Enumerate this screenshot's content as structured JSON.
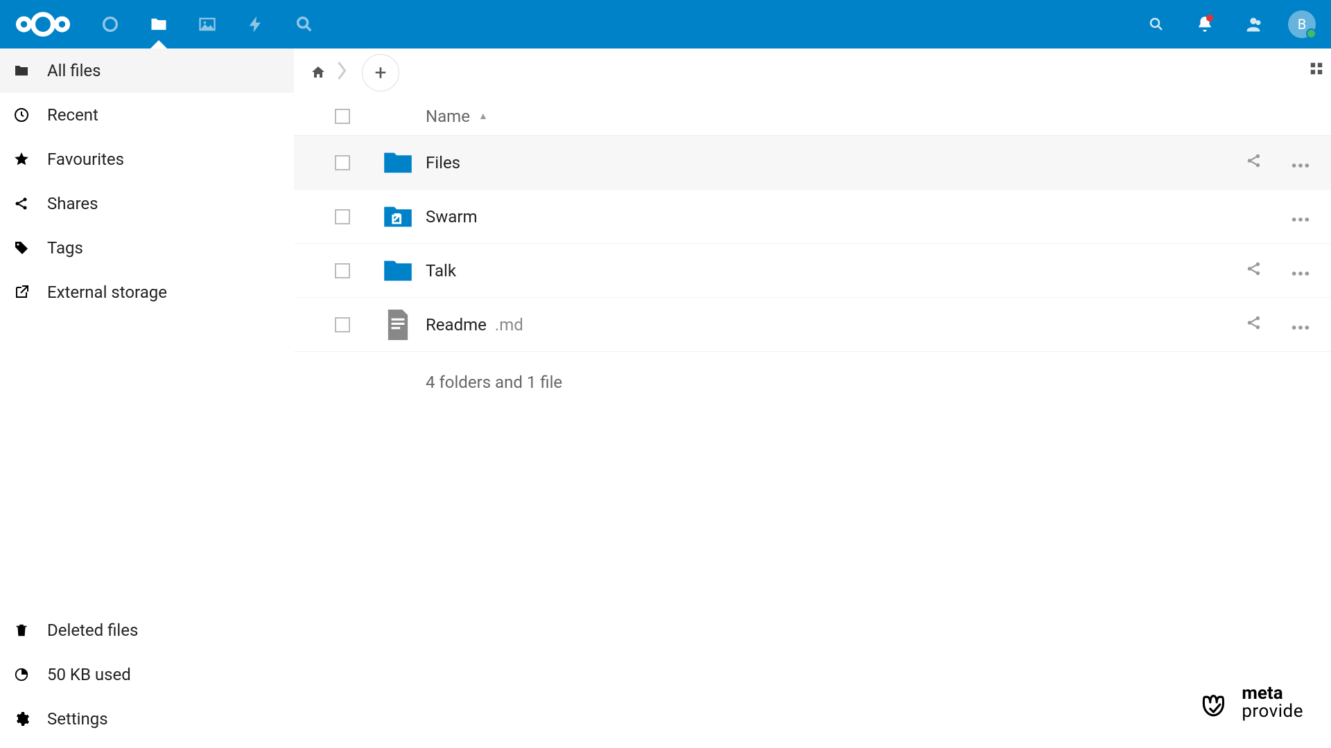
{
  "header": {
    "avatar_initial": "B"
  },
  "sidebar": {
    "items": [
      {
        "label": "All files"
      },
      {
        "label": "Recent"
      },
      {
        "label": "Favourites"
      },
      {
        "label": "Shares"
      },
      {
        "label": "Tags"
      },
      {
        "label": "External storage"
      }
    ],
    "bottom": {
      "deleted": "Deleted files",
      "quota": "50 KB used",
      "settings": "Settings"
    }
  },
  "table": {
    "header_name": "Name",
    "rows": [
      {
        "name": "Files",
        "ext": "",
        "icon": "folder",
        "share": true,
        "hover": true
      },
      {
        "name": "Swarm",
        "ext": "",
        "icon": "folder-external",
        "share": false,
        "hover": false
      },
      {
        "name": "Talk",
        "ext": "",
        "icon": "folder",
        "share": true,
        "hover": false
      },
      {
        "name": "Readme",
        "ext": ".md",
        "icon": "file-text",
        "share": true,
        "hover": false
      }
    ],
    "summary": "4 folders and 1 file"
  },
  "watermark": {
    "line1": "meta",
    "line2": "provide"
  }
}
